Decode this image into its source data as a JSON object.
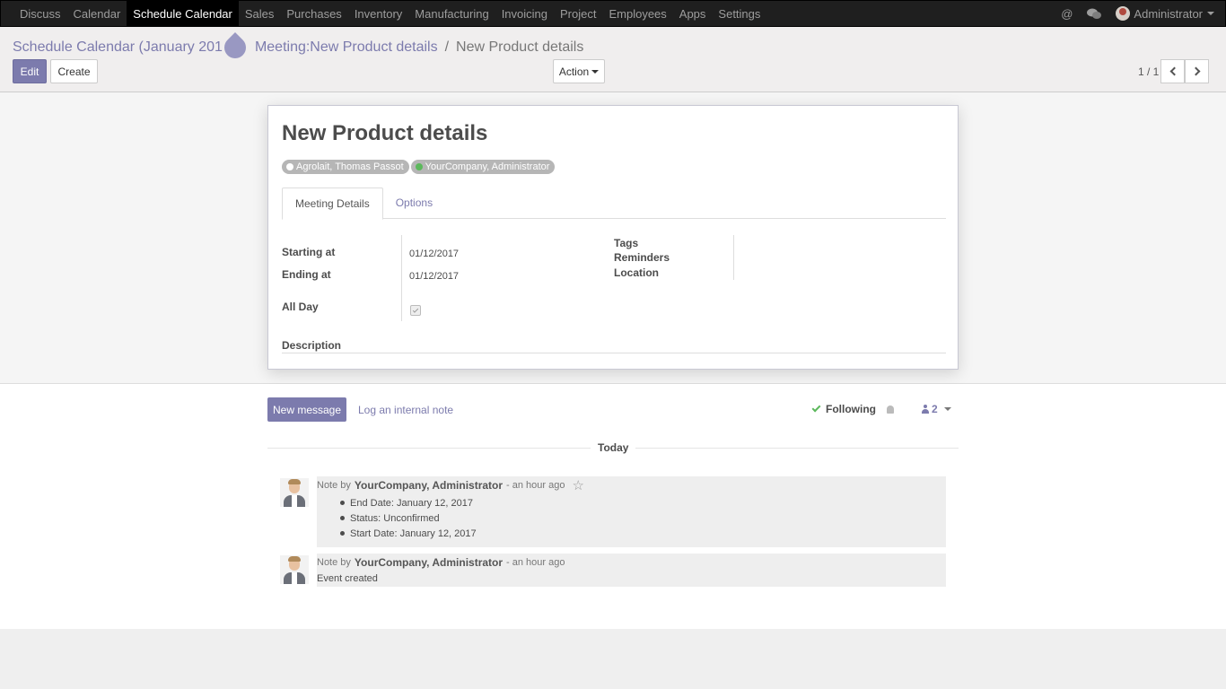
{
  "navbar": {
    "menu": [
      "Discuss",
      "Calendar",
      "Schedule Calendar",
      "Sales",
      "Purchases",
      "Inventory",
      "Manufacturing",
      "Invoicing",
      "Project",
      "Employees",
      "Apps",
      "Settings"
    ],
    "active_index": 2,
    "at_icon": "@",
    "user": "Administrator"
  },
  "breadcrumb": {
    "first": "Schedule Calendar (January 201",
    "second": "Meeting:New Product details",
    "separator": "/",
    "current": "New Product details"
  },
  "toolbar": {
    "edit_label": "Edit",
    "create_label": "Create",
    "action_label": "Action",
    "pager": "1 / 1"
  },
  "form": {
    "title": "New Product details",
    "attendees": [
      {
        "name": "Agrolait, Thomas Passot",
        "color": "#ffffff"
      },
      {
        "name": "YourCompany, Administrator",
        "color": "#5cb85c"
      }
    ],
    "tabs": [
      "Meeting Details",
      "Options"
    ],
    "starting_label": "Starting at",
    "starting_value": "01/12/2017",
    "ending_label": "Ending at",
    "ending_value": "01/12/2017",
    "allday_label": "All Day",
    "allday_checked": true,
    "tags_label": "Tags",
    "reminders_label": "Reminders",
    "location_label": "Location",
    "description_label": "Description"
  },
  "chatter": {
    "new_message_label": "New message",
    "log_note_label": "Log an internal note",
    "following_label": "Following",
    "followers_count": "2",
    "today_label": "Today",
    "messages": [
      {
        "prefix": "Note by",
        "author": "YourCompany, Administrator",
        "time": "- an hour ago",
        "items": [
          "End Date: January 12, 2017",
          "Status: Unconfirmed",
          "Start Date: January 12, 2017"
        ]
      },
      {
        "prefix": "Note by",
        "author": "YourCompany, Administrator",
        "time": "- an hour ago",
        "body": "Event created"
      }
    ]
  },
  "colors": {
    "brand": "#7c7bad",
    "navbar": "#1f1f1f"
  }
}
